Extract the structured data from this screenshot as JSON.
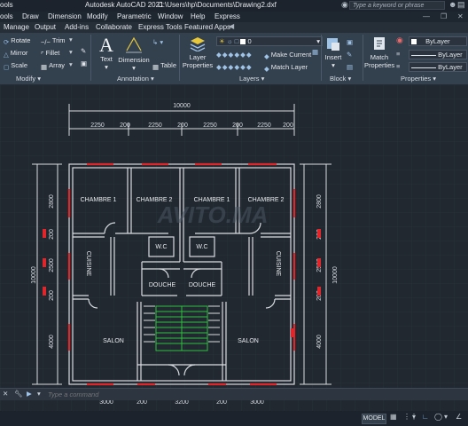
{
  "titlebar": {
    "left_fragment": "ools",
    "app_title": "Autodesk AutoCAD 2021",
    "file_path": "C:\\Users\\hp\\Documents\\Drawing2.dxf",
    "search_placeholder": "Type a keyword or phrase"
  },
  "menubar": {
    "items": [
      "Draw",
      "Dimension",
      "Modify",
      "Parametric",
      "Window",
      "Help",
      "Express"
    ],
    "left_fragment": "ools"
  },
  "ribbon_tabs": [
    "Manage",
    "Output",
    "Add-ins",
    "Collaborate",
    "Express Tools",
    "Featured Apps"
  ],
  "ribbon": {
    "modify": {
      "rotate": "Rotate",
      "trim": "Trim",
      "mirror": "Mirror",
      "fillet": "Fillet",
      "scale": "Scale",
      "array": "Array",
      "panel_label": "Modify"
    },
    "annotation": {
      "text": "Text",
      "dimension": "Dimension",
      "table": "Table",
      "panel_label": "Annotation"
    },
    "layers": {
      "layer_properties_1": "Layer",
      "layer_properties_2": "Properties",
      "current_layer": "0",
      "make_current": "Make Current",
      "match_layer": "Match Layer",
      "panel_label": "Layers"
    },
    "block": {
      "insert": "Insert",
      "panel_label": "Block"
    },
    "properties": {
      "match_1": "Match",
      "match_2": "Properties",
      "bylayer_1": "ByLayer",
      "bylayer_2": "ByLayer",
      "bylayer_3": "ByLayer",
      "panel_label": "Properties"
    }
  },
  "drawing": {
    "dims_top": {
      "overall": "10000",
      "d1": "2250",
      "d2": "200",
      "d3": "2250",
      "d4": "200",
      "d5": "2250",
      "d6": "200",
      "d7": "2250",
      "d8": "200"
    },
    "dims_left": {
      "overall": "10000",
      "d1": "2800",
      "d2": "200",
      "d3": "2500",
      "d4": "200",
      "d5": "4000"
    },
    "dims_right": {
      "overall": "10000",
      "d1": "2800",
      "d2": "200",
      "d3": "2500",
      "d4": "200",
      "d5": "4000"
    },
    "dims_bottom": {
      "d1": "3000",
      "d2": "200",
      "d3": "3200",
      "d4": "200",
      "d5": "3000"
    },
    "rooms": {
      "chambre1_a": "CHAMBRE 1",
      "chambre2_a": "CHAMBRE 2",
      "chambre1_b": "CHAMBRE 1",
      "chambre2_b": "CHAMBRE 2",
      "wc_a": "W.C",
      "wc_b": "W.C",
      "cuisine_a": "CUISINE",
      "cuisine_b": "CUISINE",
      "douche_a": "DOUCHE",
      "douche_b": "DOUCHE",
      "salon_a": "SALON",
      "salon_b": "SALON"
    },
    "watermark": "AVITO.MA"
  },
  "cmdline": {
    "placeholder": "Type a command"
  },
  "statusbar": {
    "model": "MODEL"
  },
  "colors": {
    "wall": "#d9dde2",
    "window": "#e0262b",
    "stair": "#2fbf3f",
    "grid": "#2a323c",
    "background": "#212830"
  }
}
